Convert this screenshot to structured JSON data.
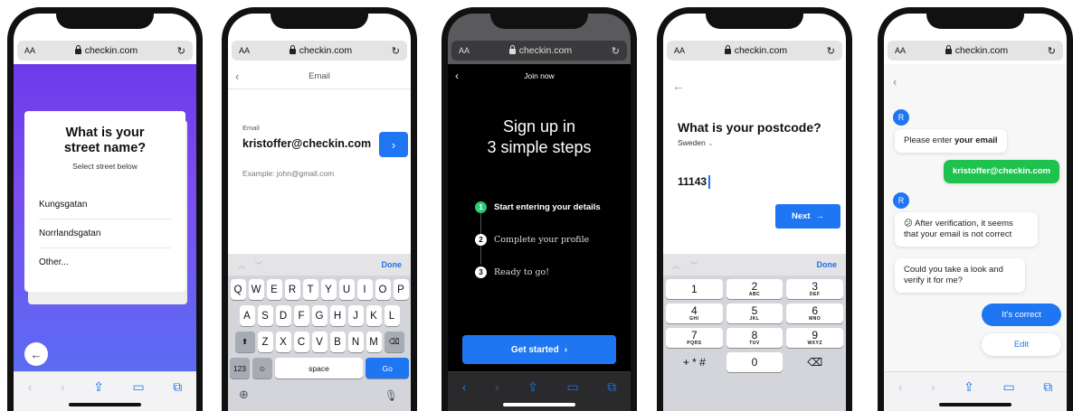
{
  "browser": {
    "aa_label": "AA",
    "url": "checkin.com",
    "reload_icon": "reload-icon"
  },
  "screen1": {
    "question": "What is your street name?",
    "subtitle": "Select street below",
    "options": [
      "Kungsgatan",
      "Norrlandsgatan",
      "Other..."
    ],
    "back_icon": "←"
  },
  "screen2": {
    "header_title": "Email",
    "field_label": "Email",
    "email_value": "kristoffer@checkin.com",
    "submit_icon": "›",
    "example": "Example: john@gmail.com",
    "kb_done": "Done",
    "kb_rows": [
      [
        "Q",
        "W",
        "E",
        "R",
        "T",
        "Y",
        "U",
        "I",
        "O",
        "P"
      ],
      [
        "A",
        "S",
        "D",
        "F",
        "G",
        "H",
        "J",
        "K",
        "L"
      ],
      [
        "Z",
        "X",
        "C",
        "V",
        "B",
        "N",
        "M"
      ]
    ],
    "kb_123": "123",
    "kb_space": "space",
    "kb_go": "Go"
  },
  "screen3": {
    "header_title": "Join now",
    "title_line1": "Sign up in",
    "title_line2": "3 simple steps",
    "steps": [
      {
        "num": "1",
        "label": "Start entering your details"
      },
      {
        "num": "2",
        "label": "Complete your profile"
      },
      {
        "num": "3",
        "label": "Ready to go!"
      }
    ],
    "cta": "Get started",
    "cta_icon": "›"
  },
  "screen4": {
    "question": "What is your postcode?",
    "country": "Sweden",
    "postcode": "11143",
    "next_label": "Next",
    "next_icon": "→",
    "kb_done": "Done",
    "numpad": [
      [
        {
          "d": "1",
          "l": ""
        },
        {
          "d": "2",
          "l": "ABC"
        },
        {
          "d": "3",
          "l": "DEF"
        }
      ],
      [
        {
          "d": "4",
          "l": "GHI"
        },
        {
          "d": "5",
          "l": "JKL"
        },
        {
          "d": "6",
          "l": "MNO"
        }
      ],
      [
        {
          "d": "7",
          "l": "PQRS"
        },
        {
          "d": "8",
          "l": "TUV"
        },
        {
          "d": "9",
          "l": "WXYZ"
        }
      ],
      [
        {
          "d": "+ * #",
          "l": ""
        },
        {
          "d": "0",
          "l": ""
        },
        {
          "d": "⌫",
          "l": ""
        }
      ]
    ]
  },
  "screen5": {
    "avatar_letter": "R",
    "bot_msg1_prefix": "Please enter ",
    "bot_msg1_bold": "your email",
    "user_msg": "kristoffer@checkin.com",
    "bot_msg2": "😕 After verification, it seems that your email is not correct",
    "bot_msg3": "Could you take a look and verify it for me?",
    "btn_correct": "It's correct",
    "btn_edit": "Edit"
  },
  "nav_icons": [
    "back-icon",
    "forward-icon",
    "share-icon",
    "bookmarks-icon",
    "tabs-icon"
  ],
  "colors": {
    "accent": "#1f76f3",
    "success": "#1fc24f",
    "gradient_top": "#6d3bea",
    "gradient_bottom": "#5a6cf2"
  }
}
